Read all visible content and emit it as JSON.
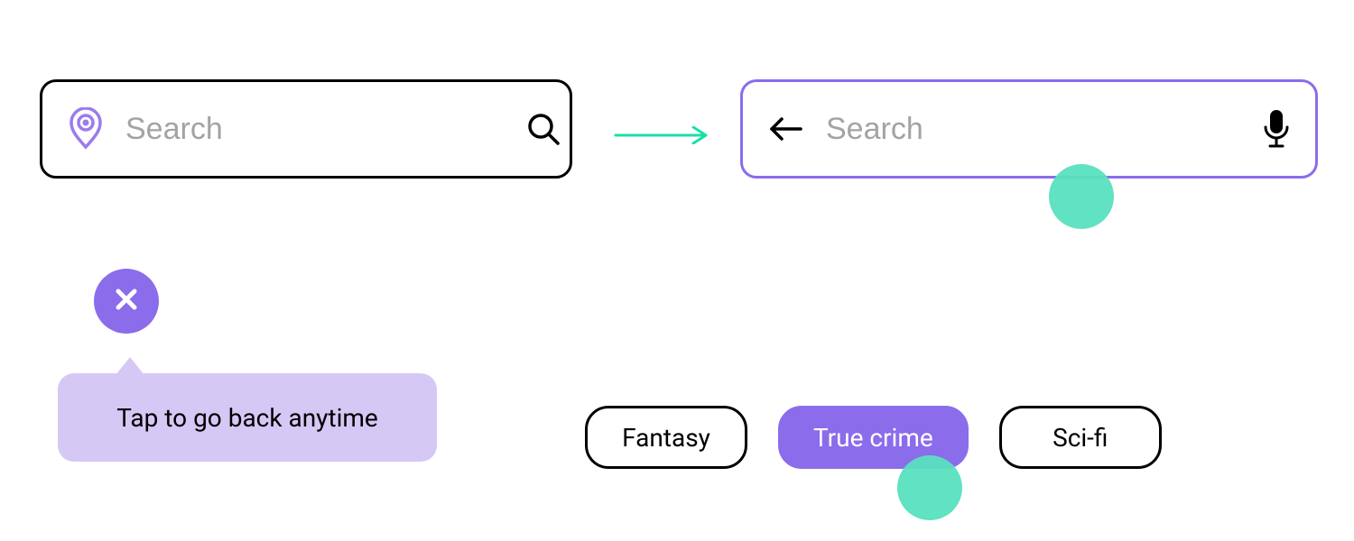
{
  "colors": {
    "accent": "#8B6CEB",
    "accent_light": "#D6C8F5",
    "touch": "#58E0BF",
    "outline": "#000000",
    "placeholder": "#A3A3A3"
  },
  "search_default": {
    "placeholder": "Search"
  },
  "search_active": {
    "placeholder": "Search"
  },
  "tooltip": {
    "text": "Tap to go back anytime"
  },
  "chips": [
    {
      "label": "Fantasy",
      "selected": false
    },
    {
      "label": "True crime",
      "selected": true
    },
    {
      "label": "Sci-fi",
      "selected": false
    }
  ]
}
